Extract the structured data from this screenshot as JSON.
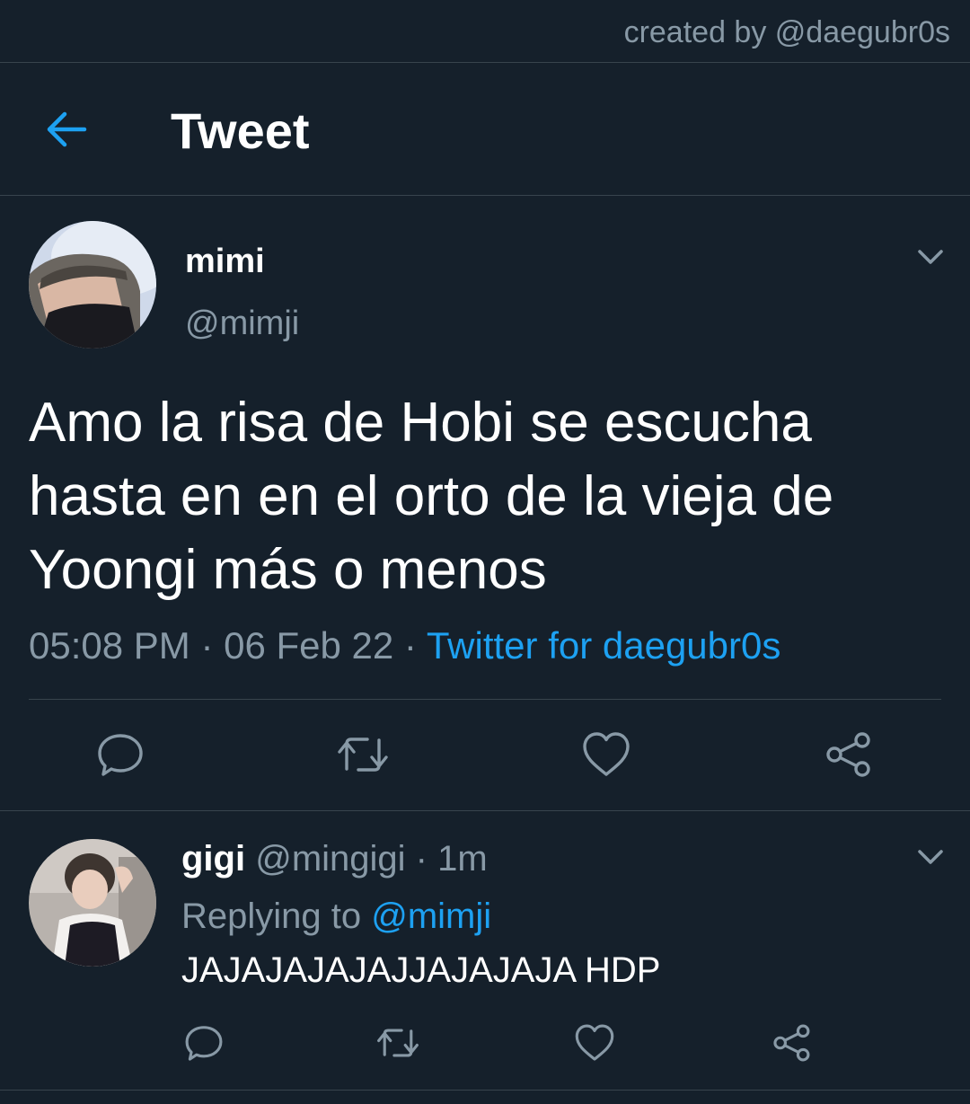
{
  "credit": "created by @daegubr0s",
  "header": {
    "title": "Tweet",
    "back_icon": "arrow-left-icon"
  },
  "tweet": {
    "display_name": "mimi",
    "handle": "@mimji",
    "text": "Amo la risa de Hobi se escucha hasta en en el orto de la vieja de Yoongi más o menos",
    "time": "05:08 PM",
    "sep1": " · ",
    "date": "06 Feb 22",
    "sep2": " · ",
    "source": "Twitter for daegubr0s",
    "actions": [
      "reply-icon",
      "retweet-icon",
      "like-icon",
      "share-icon"
    ]
  },
  "reply": {
    "display_name": "gigi",
    "handle": "@mingigi",
    "sep": " · ",
    "time": "1m",
    "replying_to_label": "Replying to ",
    "replying_to_handle": "@mimji",
    "text": "JAJAJAJAJAJJAJAJAJA HDP",
    "actions": [
      "reply-icon",
      "retweet-icon",
      "like-icon",
      "share-icon"
    ]
  },
  "colors": {
    "background": "#15202b",
    "divider": "#38444d",
    "muted": "#8899a6",
    "accent": "#1da1f2",
    "text": "#ffffff"
  }
}
